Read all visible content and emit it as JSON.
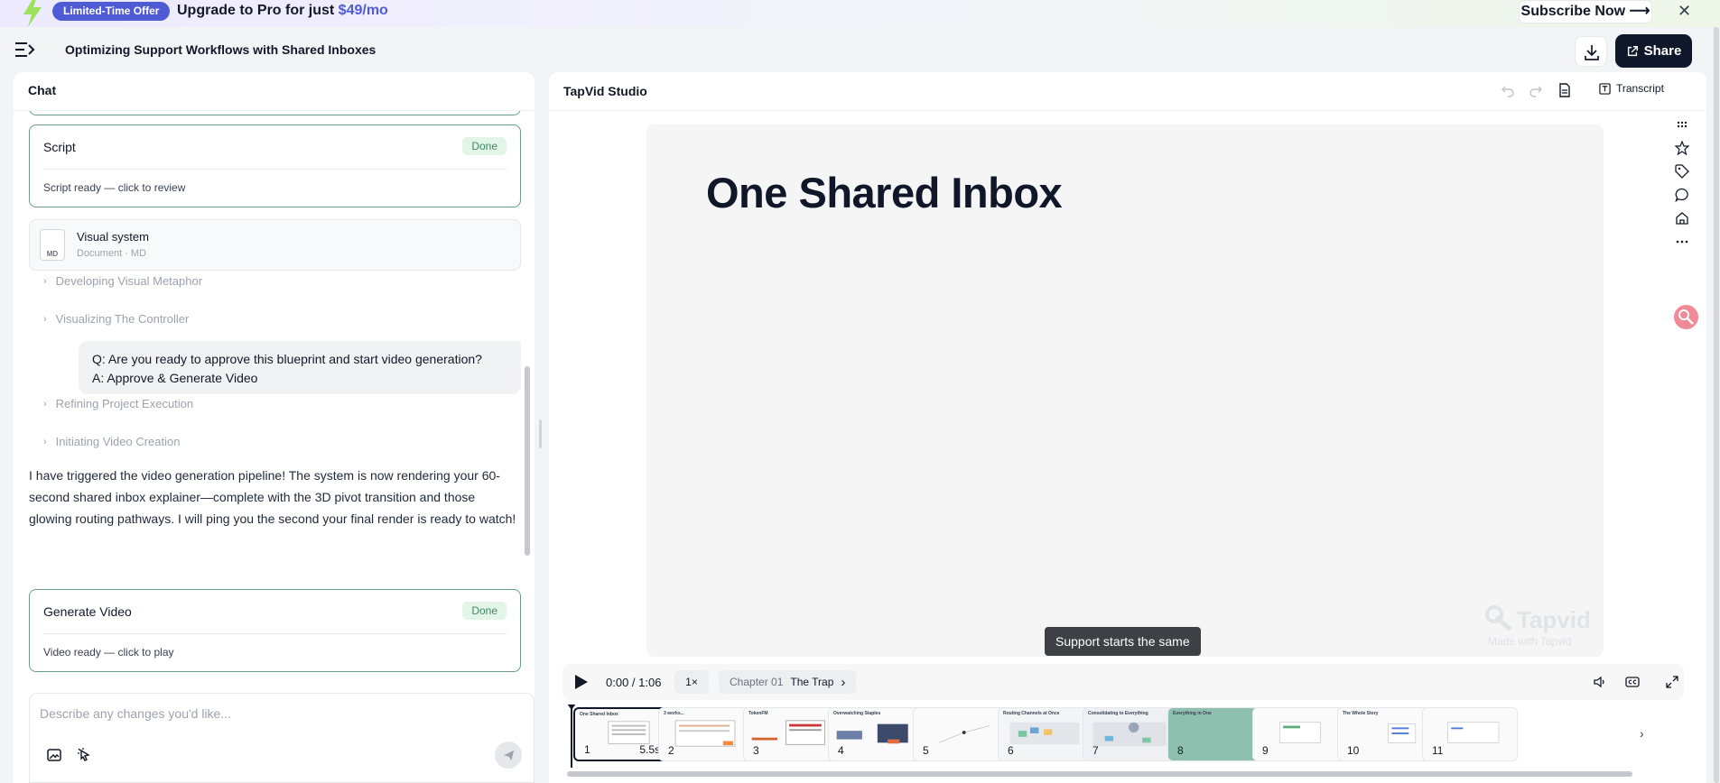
{
  "promo": {
    "badge": "Limited-Time Offer",
    "offer_text": "Upgrade to Pro for just ",
    "price": "$49/mo",
    "subscribe_label": "Subscribe Now ⟶",
    "close_icon": "✕"
  },
  "header": {
    "title": "Optimizing Support Workflows with Shared Inboxes",
    "share_label": "Share"
  },
  "chat": {
    "header": "Chat",
    "script_card": {
      "title": "Script",
      "status": "Done",
      "subtitle": "Script ready — click to review"
    },
    "document": {
      "icon_label": "MD",
      "title": "Visual system",
      "subtitle": "Document · MD"
    },
    "collapsed": [
      "Developing Visual Metaphor",
      "Visualizing The Controller",
      "Refining Project Execution",
      "Initiating Video Creation"
    ],
    "qa": {
      "question": "Q: Are you ready to approve this blueprint and start video generation?",
      "answer": "A: Approve & Generate Video"
    },
    "message": "I have triggered the video generation pipeline! The system is now rendering your 60-second shared inbox explainer—complete with the 3D pivot transition and those glowing routing pathways. I will ping you the second your final render is ready to watch!",
    "generate_card": {
      "title": "Generate Video",
      "status": "Done",
      "subtitle": "Video ready — click to play"
    },
    "composer_placeholder": "Describe any changes you'd like..."
  },
  "studio": {
    "title": "TapVid Studio",
    "transcript_label": "Transcript",
    "slide_title": "One Shared Inbox",
    "caption": "Support starts the same",
    "watermark": {
      "name": "Tapvid",
      "sub": "Made with Tapvid"
    },
    "player": {
      "time": "0:00 / 1:06",
      "speed": "1×",
      "chapter_num": "Chapter 01",
      "chapter_name": "The Trap"
    },
    "thumbnails": [
      {
        "num": "1",
        "duration": "5.5s",
        "label": "One Shared Inbox"
      },
      {
        "num": "2",
        "duration": "",
        "label": "3 works..."
      },
      {
        "num": "3",
        "duration": "",
        "label": "TokenFM"
      },
      {
        "num": "4",
        "duration": "",
        "label": "Overwatching Staples"
      },
      {
        "num": "5",
        "duration": "",
        "label": ""
      },
      {
        "num": "6",
        "duration": "",
        "label": "Routing Channels at Once"
      },
      {
        "num": "7",
        "duration": "",
        "label": "Consolidating to Everything"
      },
      {
        "num": "8",
        "duration": "",
        "label": "Everything in One"
      },
      {
        "num": "9",
        "duration": "",
        "label": ""
      },
      {
        "num": "10",
        "duration": "",
        "label": "The Whole Story"
      },
      {
        "num": "11",
        "duration": "",
        "label": ""
      }
    ]
  },
  "colors": {
    "accent": "#4f5bd5",
    "done_green": "#3f8a5c",
    "dark": "#0f172a"
  }
}
